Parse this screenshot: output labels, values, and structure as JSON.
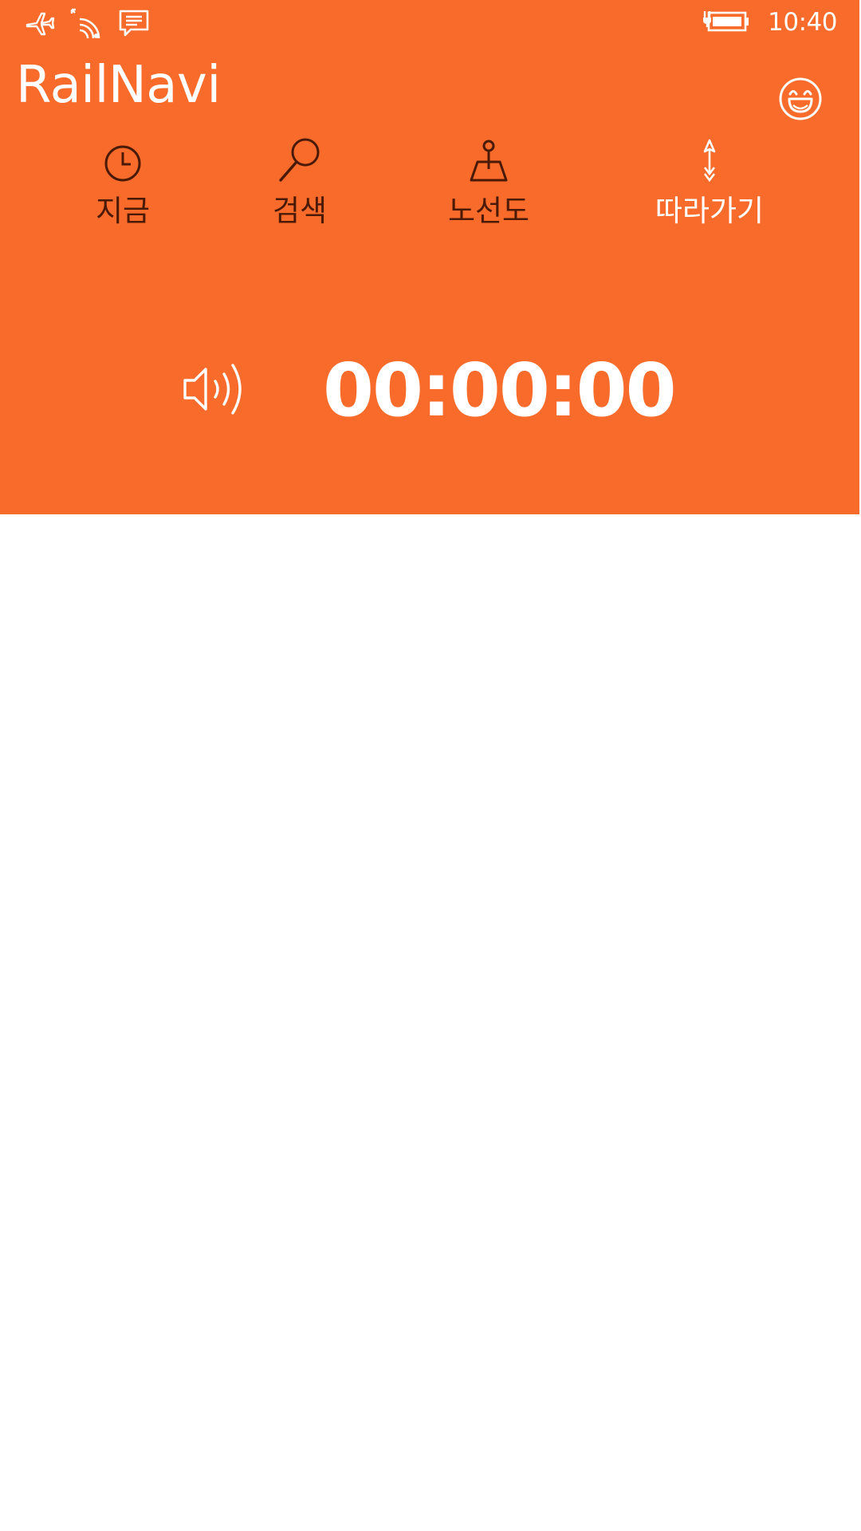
{
  "status_bar": {
    "time": "10:40",
    "icons": [
      "airplane-mode-icon",
      "wifi-icon",
      "message-icon",
      "battery-charging-icon"
    ]
  },
  "app": {
    "title": "RailNavi",
    "accent_color": "#F96B2A",
    "profile_icon": "smiley-face-icon"
  },
  "nav": {
    "items": [
      {
        "label": "지금",
        "icon": "clock-icon",
        "active": false
      },
      {
        "label": "검색",
        "icon": "search-icon",
        "active": false
      },
      {
        "label": "노선도",
        "icon": "map-pin-icon",
        "active": false
      },
      {
        "label": "따라가기",
        "icon": "navigation-arrow-icon",
        "active": true
      }
    ]
  },
  "player": {
    "icon": "speaker-volume-icon",
    "timer": "00:00:00"
  }
}
